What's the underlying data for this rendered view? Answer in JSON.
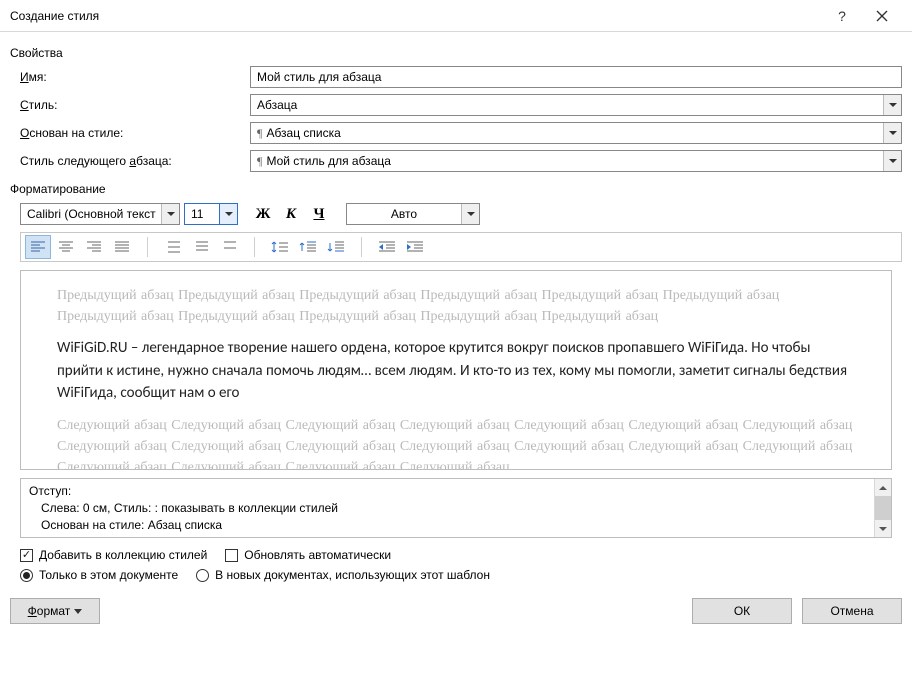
{
  "title": "Создание стиля",
  "section_properties": "Свойства",
  "labels": {
    "name": "Имя:",
    "name_u": "И",
    "style": "тиль:",
    "style_u": "С",
    "based": "снован на стиле:",
    "based_u": "О",
    "next": "Стиль следующего ",
    "next_u": "а",
    "next2": "бзаца:"
  },
  "fields": {
    "name": "Мой стиль для абзаца",
    "style": "Абзаца",
    "based": "Абзац списка",
    "next": "Мой стиль для абзаца"
  },
  "section_format": "Форматирование",
  "format": {
    "font": "Calibri (Основной текст",
    "size": "11",
    "bold": "Ж",
    "italic": "К",
    "underline": "Ч",
    "color": "Авто"
  },
  "preview": {
    "prev_para": "Предыдущий абзац Предыдущий абзац Предыдущий абзац Предыдущий абзац Предыдущий абзац Предыдущий абзац Предыдущий абзац Предыдущий абзац Предыдущий абзац Предыдущий абзац Предыдущий абзац",
    "sample": "WiFiGiD.RU – легендарное творение нашего ордена, которое крутится вокруг поисков пропавшего WiFiГида. Но чтобы прийти к истине, нужно сначала помочь людям… всем людям. И кто-то из тех, кому мы помогли, заметит сигналы бедствия WiFiГида, сообщит нам о его",
    "next_para": "Следующий абзац Следующий абзац Следующий абзац Следующий абзац Следующий абзац Следующий абзац Следующий абзац Следующий абзац Следующий абзац Следующий абзац Следующий абзац Следующий абзац Следующий абзац Следующий абзац Следующий абзац Следующий абзац Следующий абзац Следующий абзац"
  },
  "desc": {
    "line1": "Отступ:",
    "line2": "Слева:  0 см, Стиль: : показывать в коллекции стилей",
    "line3": "Основан на стиле: Абзац списка"
  },
  "checks": {
    "add_collection": "Добавить в коллекцию стилей",
    "auto_update": "Обновлять автоматически",
    "only_doc": "Только в этом документе",
    "new_docs": "В новых документах, использующих этот шаблон"
  },
  "buttons": {
    "format": "Формат",
    "format_u": "Ф",
    "format_rest": "ормат",
    "ok": "ОК",
    "cancel": "Отмена"
  }
}
